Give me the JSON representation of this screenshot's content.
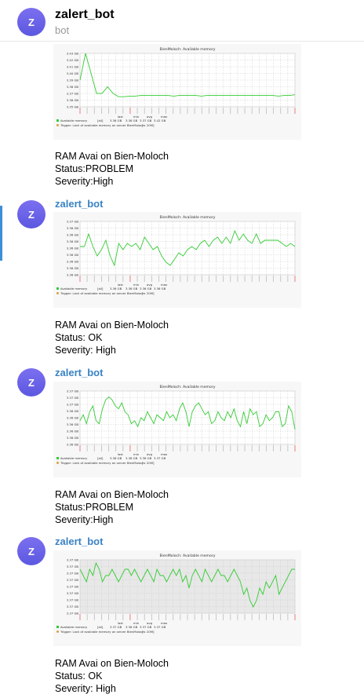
{
  "header": {
    "avatar_letter": "Z",
    "title": "zalert_bot",
    "subtitle": "bot"
  },
  "messages": [
    {
      "sender": "",
      "avatar_letter": "",
      "chart_data": {
        "type": "line",
        "title": "BienMoloch: Available memory",
        "yticks": [
          "3.43 GB",
          "3.42 GB",
          "3.41 GB",
          "3.40 GB",
          "3.39 GB",
          "3.38 GB",
          "3.37 GB",
          "3.36 GB",
          "3.35 GB"
        ],
        "ylim": [
          3.35,
          3.43
        ],
        "values": [
          3.39,
          3.43,
          3.4,
          3.37,
          3.37,
          3.38,
          3.37,
          3.365,
          3.365,
          3.366,
          3.366,
          3.367,
          3.367,
          3.367,
          3.367,
          3.367,
          3.367,
          3.366,
          3.367,
          3.367,
          3.367,
          3.367,
          3.366,
          3.367,
          3.367,
          3.367,
          3.367,
          3.367,
          3.367,
          3.367,
          3.367,
          3.367,
          3.367,
          3.367,
          3.367,
          3.367,
          3.366,
          3.367,
          3.367,
          3.368
        ],
        "series": [
          {
            "name": "Available memory",
            "color": "#33cc33"
          }
        ],
        "legend": {
          "name": "Available memory",
          "agg": "[all]",
          "last": "3.36 GB",
          "min": "3.36 GB",
          "avg": "3.37 GB",
          "max": "3.42 GB"
        },
        "trigger": "Trigger: Lack of available memory on server BienMoloch",
        "trigger_cond": "[< 20M]",
        "background": "#ffffff"
      },
      "text": {
        "line1": "RAM Avai on Bien-Moloch",
        "line2": "Status:PROBLEM",
        "line3": "Severity:High"
      }
    },
    {
      "sender": "zalert_bot",
      "avatar_letter": "Z",
      "chart_data": {
        "type": "line",
        "title": "BienMoloch: Available memory",
        "yticks": [
          "3.37 GB",
          "3.36 GB",
          "3.36 GB",
          "3.36 GB",
          "3.36 GB",
          "3.36 GB",
          "3.36 GB",
          "3.36 GB",
          "3.36 GB"
        ],
        "ylim": [
          3.355,
          3.372
        ],
        "values": [
          3.364,
          3.364,
          3.368,
          3.364,
          3.361,
          3.363,
          3.366,
          3.361,
          3.358,
          3.365,
          3.363,
          3.365,
          3.364,
          3.365,
          3.363,
          3.367,
          3.365,
          3.363,
          3.364,
          3.361,
          3.359,
          3.358,
          3.36,
          3.362,
          3.361,
          3.363,
          3.364,
          3.363,
          3.365,
          3.366,
          3.364,
          3.366,
          3.367,
          3.365,
          3.367,
          3.365,
          3.369,
          3.366,
          3.368,
          3.366,
          3.365,
          3.368,
          3.365,
          3.366,
          3.366,
          3.366,
          3.366,
          3.365,
          3.364,
          3.365,
          3.364
        ],
        "series": [
          {
            "name": "Available memory",
            "color": "#33cc33"
          }
        ],
        "legend": {
          "name": "Available memory",
          "agg": "[all]",
          "last": "3.36 GB",
          "min": "3.36 GB",
          "avg": "3.36 GB",
          "max": "3.36 GB"
        },
        "trigger": "Trigger: Lack of available memory on server BienMoloch",
        "trigger_cond": "[< 20M]",
        "background": "#ffffff"
      },
      "text": {
        "line1": "RAM Avai on Bien-Moloch",
        "line2": "Status: OK",
        "line3": "Severity: High"
      }
    },
    {
      "sender": "zalert_bot",
      "avatar_letter": "Z",
      "chart_data": {
        "type": "line",
        "title": "BienMoloch: Available memory",
        "yticks": [
          "3.37 GB",
          "3.37 GB",
          "3.37 GB",
          "3.36 GB",
          "3.36 GB",
          "3.36 GB",
          "3.36 GB",
          "3.36 GB",
          "3.36 GB"
        ],
        "ylim": [
          3.355,
          3.373
        ],
        "values": [
          3.363,
          3.365,
          3.362,
          3.366,
          3.368,
          3.363,
          3.362,
          3.367,
          3.37,
          3.371,
          3.37,
          3.368,
          3.367,
          3.369,
          3.366,
          3.365,
          3.362,
          3.363,
          3.361,
          3.364,
          3.363,
          3.366,
          3.364,
          3.362,
          3.365,
          3.364,
          3.363,
          3.366,
          3.364,
          3.365,
          3.363,
          3.367,
          3.369,
          3.366,
          3.361,
          3.366,
          3.368,
          3.369,
          3.367,
          3.365,
          3.366,
          3.362,
          3.363,
          3.366,
          3.364,
          3.363,
          3.366,
          3.364,
          3.367,
          3.363,
          3.361,
          3.366,
          3.362,
          3.367,
          3.365,
          3.366,
          3.361,
          3.362,
          3.365,
          3.363,
          3.364,
          3.366,
          3.366,
          3.361,
          3.362,
          3.368,
          3.366,
          3.36
        ],
        "series": [
          {
            "name": "Available memory",
            "color": "#33cc33"
          }
        ],
        "legend": {
          "name": "Available memory",
          "agg": "[all]",
          "last": "3.36 GB",
          "min": "3.36 GB",
          "avg": "3.36 GB",
          "max": "3.37 GB"
        },
        "trigger": "Trigger: Lack of available memory on server BienMoloch",
        "trigger_cond": "[< 20M]",
        "background": "#ffffff"
      },
      "text": {
        "line1": "RAM Avai on Bien-Moloch",
        "line2": "Status:PROBLEM",
        "line3": "Severity:High"
      }
    },
    {
      "sender": "zalert_bot",
      "avatar_letter": "Z",
      "chart_data": {
        "type": "line",
        "title": "BienMoloch: Available memory",
        "yticks": [
          "3.37 GB",
          "3.37 GB",
          "3.37 GB",
          "3.37 GB",
          "3.37 GB",
          "3.37 GB",
          "3.37 GB",
          "3.37 GB",
          "3.37 GB"
        ],
        "ylim": [
          3.366,
          3.3745
        ],
        "values": [
          3.373,
          3.372,
          3.371,
          3.373,
          3.372,
          3.374,
          3.373,
          3.371,
          3.372,
          3.372,
          3.373,
          3.372,
          3.371,
          3.372,
          3.373,
          3.373,
          3.372,
          3.373,
          3.372,
          3.371,
          3.372,
          3.373,
          3.372,
          3.371,
          3.373,
          3.372,
          3.372,
          3.371,
          3.372,
          3.373,
          3.372,
          3.373,
          3.371,
          3.372,
          3.37,
          3.372,
          3.373,
          3.372,
          3.371,
          3.373,
          3.372,
          3.371,
          3.372,
          3.373,
          3.372,
          3.372,
          3.371,
          3.372,
          3.373,
          3.372,
          3.371,
          3.369,
          3.37,
          3.368,
          3.367,
          3.368,
          3.37,
          3.369,
          3.371,
          3.37,
          3.371,
          3.372,
          3.369,
          3.37,
          3.371,
          3.372,
          3.373,
          3.373
        ],
        "series": [
          {
            "name": "Available memory",
            "color": "#33cc33"
          }
        ],
        "legend": {
          "name": "Available memory",
          "agg": "[all]",
          "last": "3.37 GB",
          "min": "3.36 GB",
          "avg": "3.37 GB",
          "max": "3.37 GB"
        },
        "trigger": "Trigger: Lack of available memory on server BienMoloch",
        "trigger_cond": "[< 20M]",
        "background": "#e8e8e8"
      },
      "text": {
        "line1": "RAM Avai on Bien-Moloch",
        "line2": "Status: OK",
        "line3": "Severity: High"
      }
    }
  ]
}
